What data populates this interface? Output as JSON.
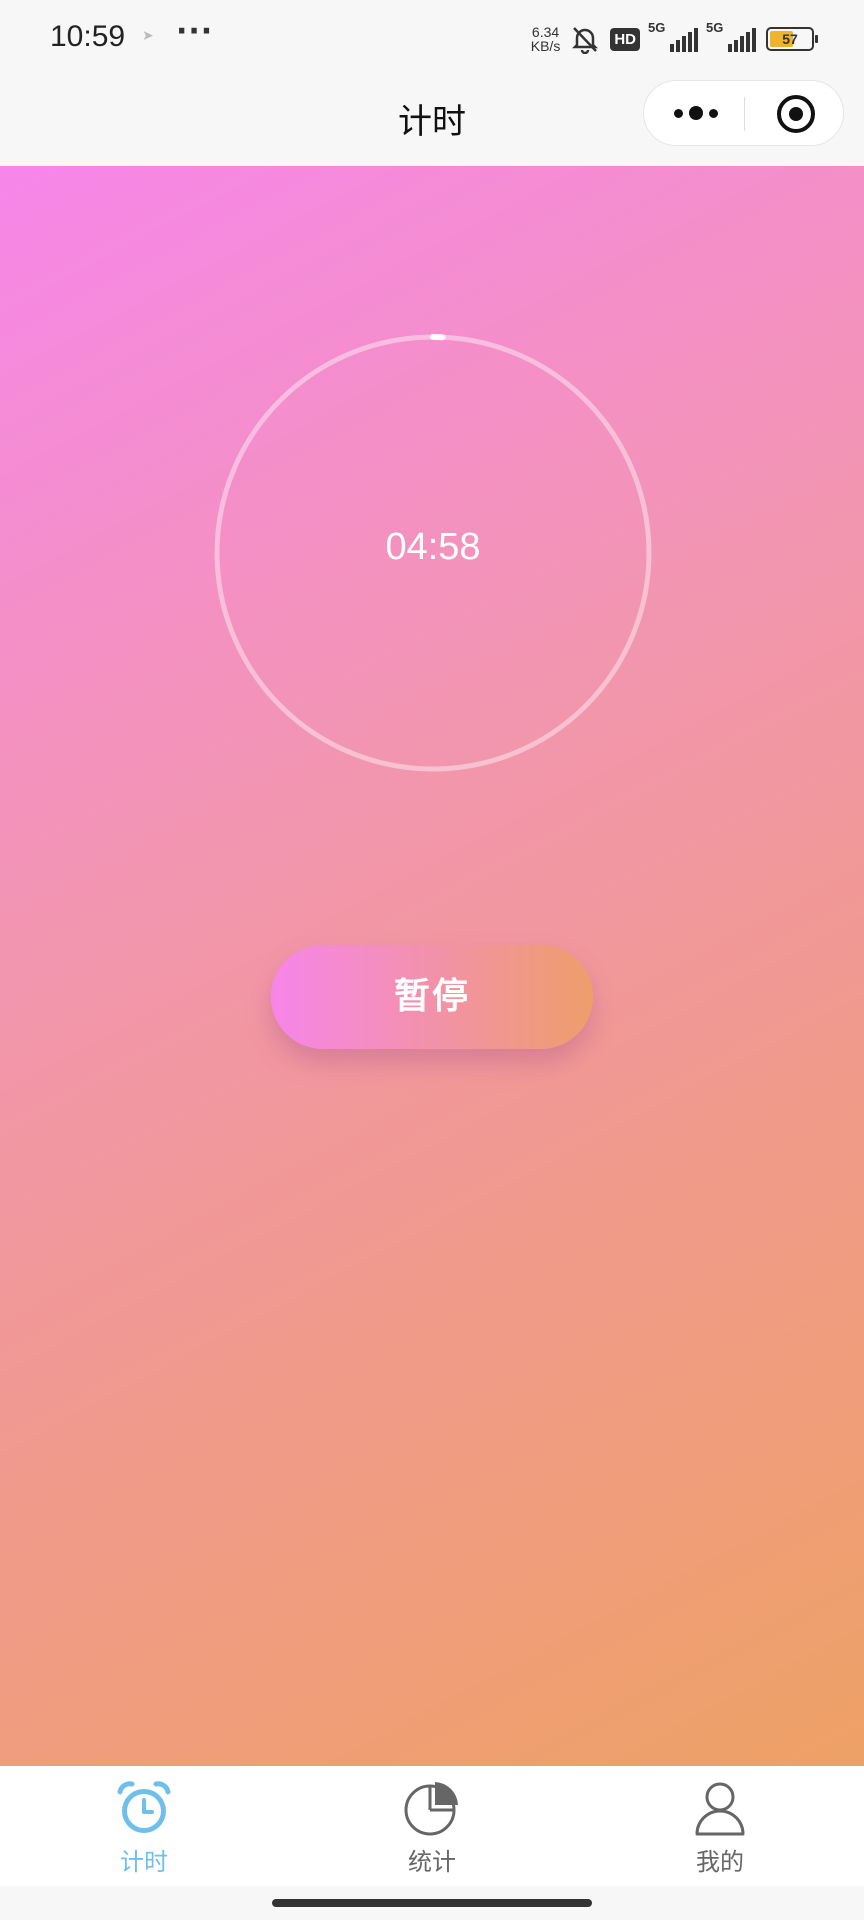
{
  "status_bar": {
    "time": "10:59",
    "more": "···",
    "net_speed_value": "6.34",
    "net_speed_unit": "KB/s",
    "hd_label": "HD",
    "signal_1_label": "5G",
    "signal_2_label": "5G",
    "battery_level": "57"
  },
  "nav": {
    "title": "计时"
  },
  "timer": {
    "display": "04:58",
    "progress_fraction": 0.007
  },
  "actions": {
    "pause_label": "暂停"
  },
  "tab_bar": {
    "tabs": [
      {
        "label": "计时",
        "icon": "alarm-clock-icon",
        "active": true
      },
      {
        "label": "统计",
        "icon": "pie-chart-icon",
        "active": false
      },
      {
        "label": "我的",
        "icon": "user-icon",
        "active": false
      }
    ]
  },
  "colors": {
    "gradient_start": "#f786ea",
    "gradient_end": "#eea165",
    "active_tab": "#6ec0ea",
    "inactive_tab": "#666666"
  }
}
